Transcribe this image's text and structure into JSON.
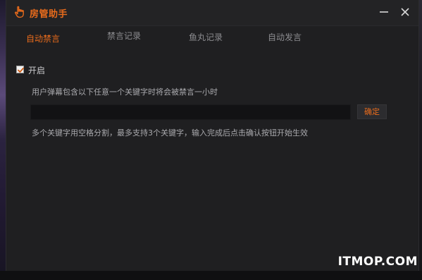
{
  "window": {
    "title": "房管助手",
    "icon": "hand-pointer-icon",
    "accent_color": "#e86b1c"
  },
  "titlebar_buttons": {
    "minimize_icon": "minimize-icon",
    "close_icon": "close-icon"
  },
  "tabs": [
    {
      "label": "自动禁言",
      "active": true
    },
    {
      "label": "禁言记录",
      "active": false
    },
    {
      "label": "鱼丸记录",
      "active": false
    },
    {
      "label": "自动发言",
      "active": false
    }
  ],
  "auto_mute": {
    "enable_label": "开启",
    "enabled": true,
    "description": "用户弹幕包含以下任意一个关键字时将会被禁言一小时",
    "keyword_value": "",
    "keyword_placeholder": "",
    "confirm_label": "确定",
    "hint": "多个关键字用空格分割，最多支持3个关键字，输入完成后点击确认按钮开始生效"
  },
  "watermark": "ITMOP.COM"
}
